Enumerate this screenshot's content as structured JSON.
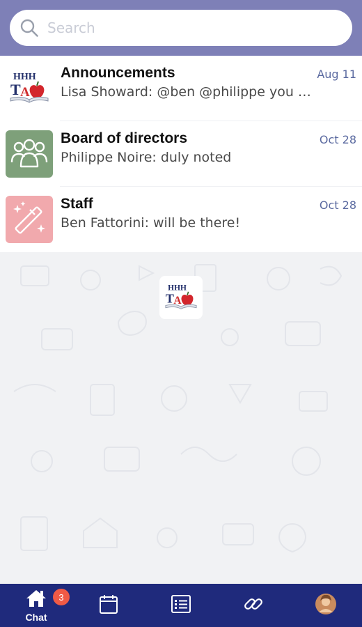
{
  "search": {
    "placeholder": "Search",
    "icon": "search-icon"
  },
  "chats": [
    {
      "title": "Announcements",
      "preview": "Lisa Showard: @ben @philippe you …",
      "date": "Aug 11",
      "avatar": "hhhta-logo",
      "avatar_bg": "#ffffff"
    },
    {
      "title": "Board of directors",
      "preview": "Philippe Noire: duly noted",
      "date": "Oct 28",
      "avatar": "group-icon",
      "avatar_bg": "#7ea07a"
    },
    {
      "title": "Staff",
      "preview": "Ben Fattorini: will be there!",
      "date": "Oct 28",
      "avatar": "magic-wand-icon",
      "avatar_bg": "#f1a9ad"
    }
  ],
  "logo": {
    "text_top": "HHH",
    "text_bottom": "TA"
  },
  "nav": {
    "chat_label": "Chat",
    "chat_badge": "3",
    "items": [
      "home-icon",
      "calendar-icon",
      "list-icon",
      "link-icon",
      "profile-avatar"
    ]
  },
  "colors": {
    "header": "#7e80b7",
    "nav": "#1f2a7c",
    "badge": "#f05a46",
    "date": "#5b6aa0"
  }
}
